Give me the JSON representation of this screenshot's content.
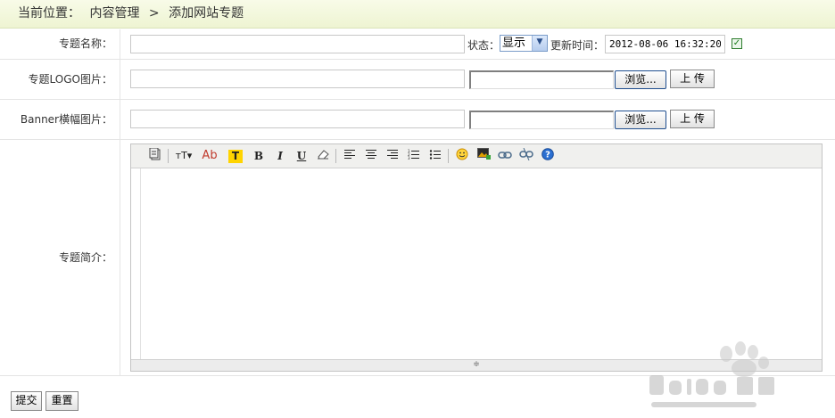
{
  "breadcrumb": {
    "prefix": "当前位置：",
    "item1": "内容管理",
    "sep": ">",
    "item2": "添加网站专题"
  },
  "form": {
    "name_label": "专题名称：",
    "name_value": "",
    "status_label": "状态：",
    "status_value": "显示",
    "update_label": "更新时间：",
    "update_value": "2012-08-06 16:32:20",
    "update_checked": true,
    "logo_label": "专题LOGO图片：",
    "banner_label": "Banner横幅图片：",
    "browse_label": "浏览...",
    "upload_label": "上 传",
    "intro_label": "专题简介："
  },
  "editor": {
    "tools": [
      "source-icon",
      "font-size-icon",
      "font-color-icon",
      "highlight-icon",
      "bold-icon",
      "italic-icon",
      "underline-icon",
      "eraser-icon",
      "align-left-icon",
      "align-center-icon",
      "align-right-icon",
      "ordered-list-icon",
      "unordered-list-icon",
      "emoticon-icon",
      "image-icon",
      "link-icon",
      "unlink-icon",
      "help-icon"
    ]
  },
  "actions": {
    "submit": "提交",
    "reset": "重置"
  },
  "watermark": {
    "logo": "Baidu经验",
    "url": "jingyan.baidu.com"
  },
  "colors": {
    "accent": "#2d7d2d",
    "breadcrumb_bg": "#eef4d2"
  }
}
